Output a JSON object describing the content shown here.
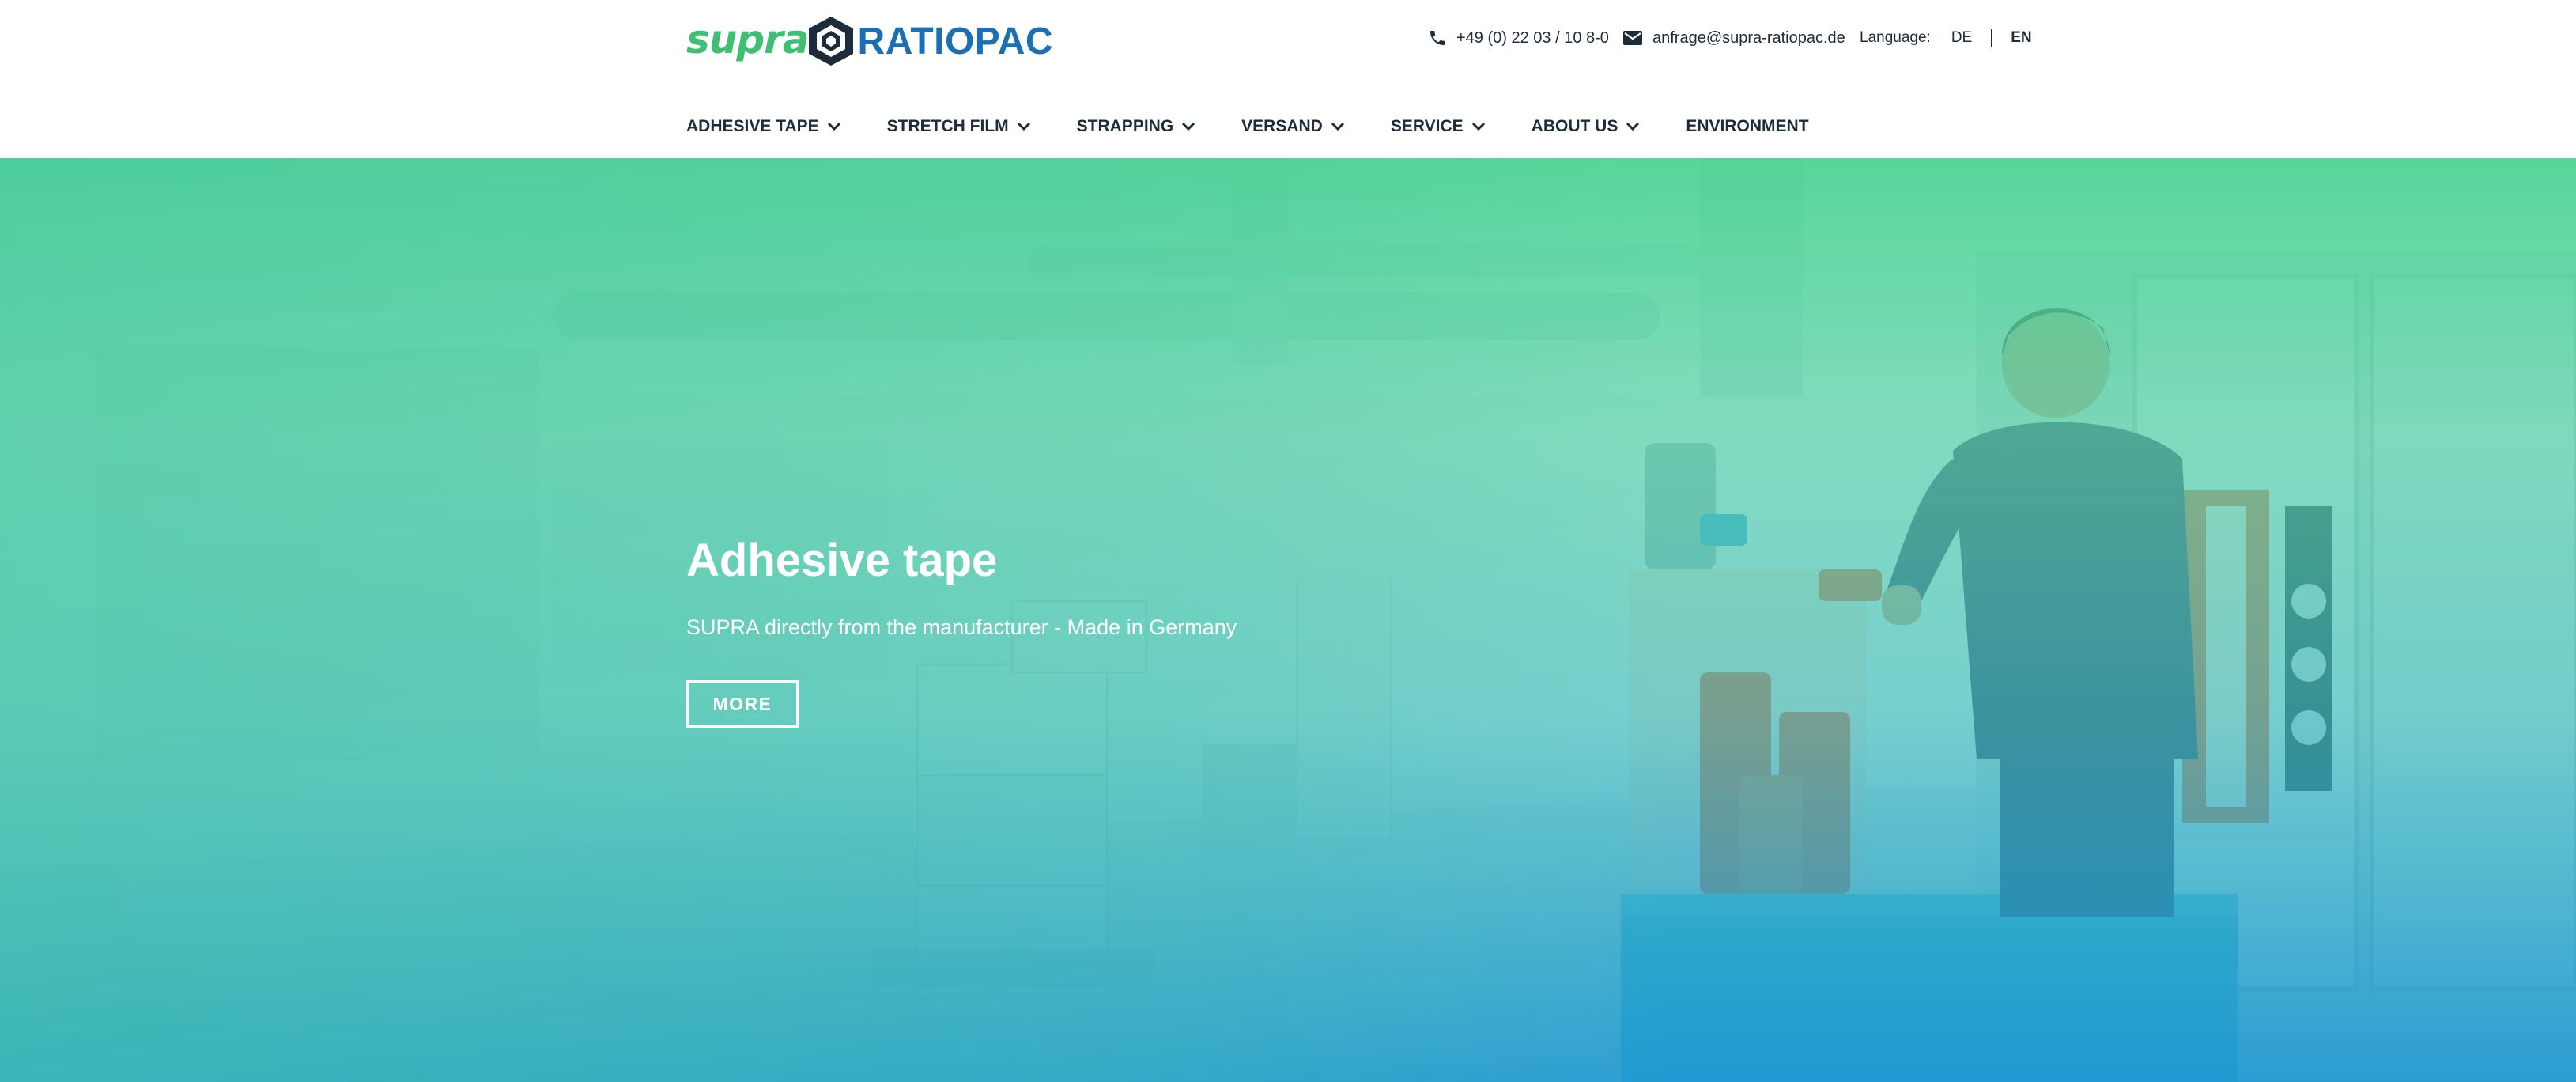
{
  "brand": {
    "logo_left": "supra",
    "logo_right": "RATIOPAC",
    "colors": {
      "green": "#3fbf73",
      "blue": "#1a6fb5",
      "dark_text": "#1d2b3a"
    }
  },
  "contact": {
    "phone": "+49 (0) 22 03 / 10 8-0",
    "phone_icon": "phone-icon",
    "email": "anfrage@supra-ratiopac.de",
    "email_icon": "mail-icon"
  },
  "language": {
    "label": "Language:",
    "options": [
      "DE",
      "EN"
    ],
    "selected": "EN"
  },
  "nav": {
    "items": [
      {
        "label": "ADHESIVE TAPE",
        "has_dropdown": true
      },
      {
        "label": "STRETCH FILM",
        "has_dropdown": true
      },
      {
        "label": "STRAPPING",
        "has_dropdown": true
      },
      {
        "label": "VERSAND",
        "has_dropdown": true
      },
      {
        "label": "SERVICE",
        "has_dropdown": true
      },
      {
        "label": "ABOUT US",
        "has_dropdown": true
      },
      {
        "label": "ENVIRONMENT",
        "has_dropdown": false
      }
    ]
  },
  "hero": {
    "title": "Adhesive tape",
    "subtitle": "SUPRA directly from the manufacturer - Made in Germany",
    "button_label": "MORE",
    "overlay_colors": [
      "#4ad392",
      "#1a96d2"
    ]
  }
}
